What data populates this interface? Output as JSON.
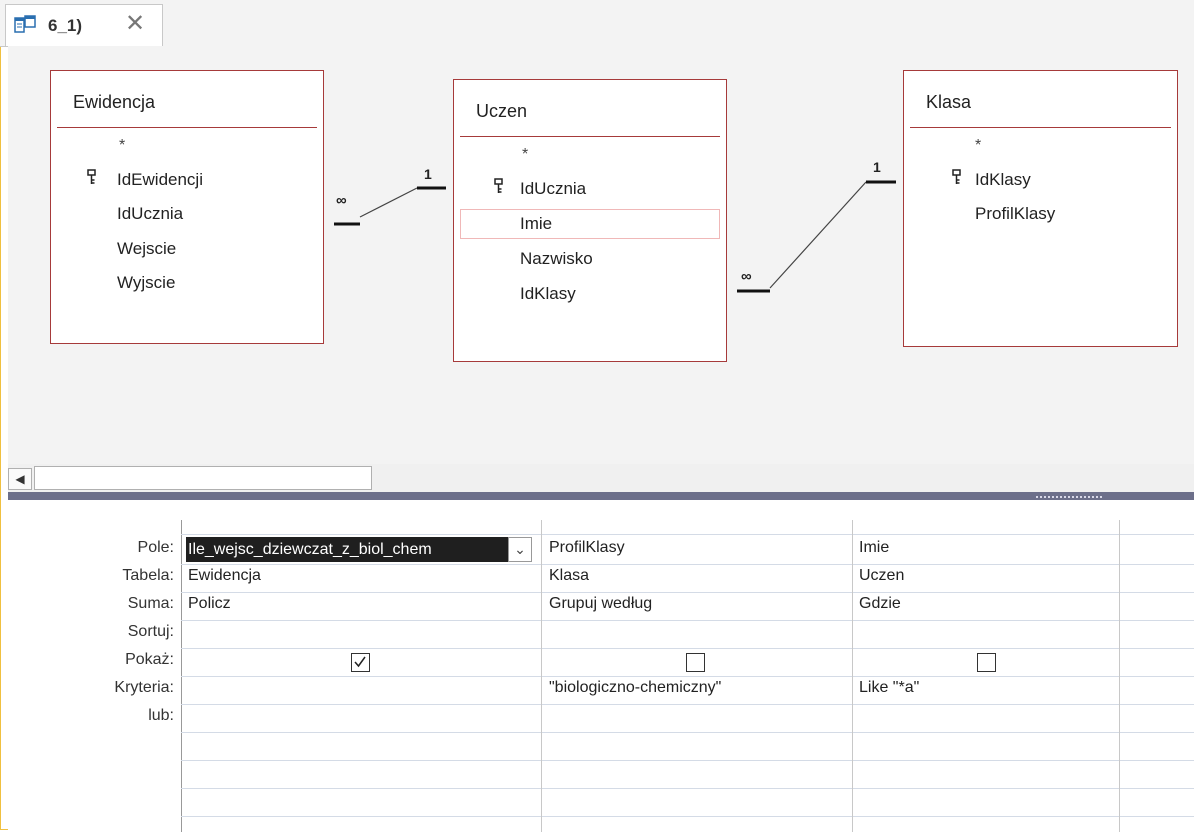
{
  "tab": {
    "label": "6_1)",
    "close": "✕"
  },
  "tables": {
    "ewidencja": {
      "title": "Ewidencja",
      "star": "*",
      "fields": [
        "IdEwidencji",
        "IdUcznia",
        "Wejscie",
        "Wyjscie"
      ]
    },
    "uczen": {
      "title": "Uczen",
      "star": "*",
      "fields": [
        "IdUcznia",
        "Imie",
        "Nazwisko",
        "IdKlasy"
      ]
    },
    "klasa": {
      "title": "Klasa",
      "star": "*",
      "fields": [
        "IdKlasy",
        "ProfilKlasy"
      ]
    }
  },
  "relations": {
    "left_one": "1",
    "left_many": "∞",
    "right_one": "1",
    "right_many": "∞"
  },
  "grid": {
    "row_labels": {
      "pole": "Pole:",
      "tabela": "Tabela:",
      "suma": "Suma:",
      "sortuj": "Sortuj:",
      "pokaz": "Pokaż:",
      "kryteria": "Kryteria:",
      "lub": "lub:"
    },
    "columns": [
      {
        "pole": "Ile_wejsc_dziewczat_z_biol_chem",
        "tabela": "Ewidencja",
        "suma": "Policz",
        "sortuj": "",
        "pokaz": true,
        "kryteria": "",
        "lub": ""
      },
      {
        "pole": "ProfilKlasy",
        "tabela": "Klasa",
        "suma": "Grupuj według",
        "sortuj": "",
        "pokaz": false,
        "kryteria": "\"biologiczno-chemiczny\"",
        "lub": ""
      },
      {
        "pole": "Imie",
        "tabela": "Uczen",
        "suma": "Gdzie",
        "sortuj": "",
        "pokaz": false,
        "kryteria": "Like \"*a\"",
        "lub": ""
      }
    ]
  },
  "colors": {
    "table_border": "#a63a3a",
    "splitter": "#6c6f8a",
    "selection": "#1f1f1f"
  }
}
